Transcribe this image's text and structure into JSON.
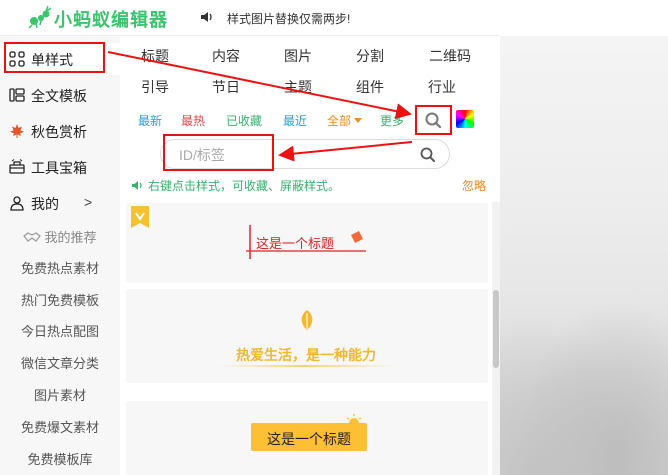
{
  "app": {
    "logo_text": "小蚂蚁编辑器",
    "notice": "样式图片替换仅需两步!"
  },
  "sidebar": {
    "items": [
      {
        "label": "单样式",
        "icon": "grid-icon"
      },
      {
        "label": "全文模板",
        "icon": "template-icon"
      },
      {
        "label": "秋色赏析",
        "icon": "maple-leaf-icon"
      },
      {
        "label": "工具宝箱",
        "icon": "toolbox-icon"
      },
      {
        "label": "我的",
        "icon": "user-icon",
        "chevron": ">"
      }
    ],
    "sub_items": [
      {
        "label": "我的推荐"
      },
      {
        "label": "免费热点素材"
      },
      {
        "label": "热门免费模板"
      },
      {
        "label": "今日热点配图"
      },
      {
        "label": "微信文章分类"
      },
      {
        "label": "图片素材"
      },
      {
        "label": "免费爆文素材"
      },
      {
        "label": "免费模板库"
      }
    ]
  },
  "categories": [
    [
      "标题",
      "内容",
      "图片",
      "分割",
      "二维码"
    ],
    [
      "引导",
      "节日",
      "主题",
      "组件",
      "行业"
    ]
  ],
  "filters": {
    "new": "最新",
    "hot": "最热",
    "favorited": "已收藏",
    "recent": "最近",
    "all": "全部",
    "more": "更多"
  },
  "search": {
    "placeholder": "ID/标签",
    "value": ""
  },
  "hint": {
    "text": "右键点击样式，可收藏、屏蔽样式。",
    "ignore": "忽略"
  },
  "cards": [
    {
      "title": "这是一个标题"
    },
    {
      "title": "热爱生活，是一种能力"
    },
    {
      "title": "这是一个标题"
    }
  ],
  "colors": {
    "brand_green": "#3cc36e",
    "annotation_red": "#e11111",
    "orange": "#f08b1c",
    "yellow": "#fdc034"
  }
}
